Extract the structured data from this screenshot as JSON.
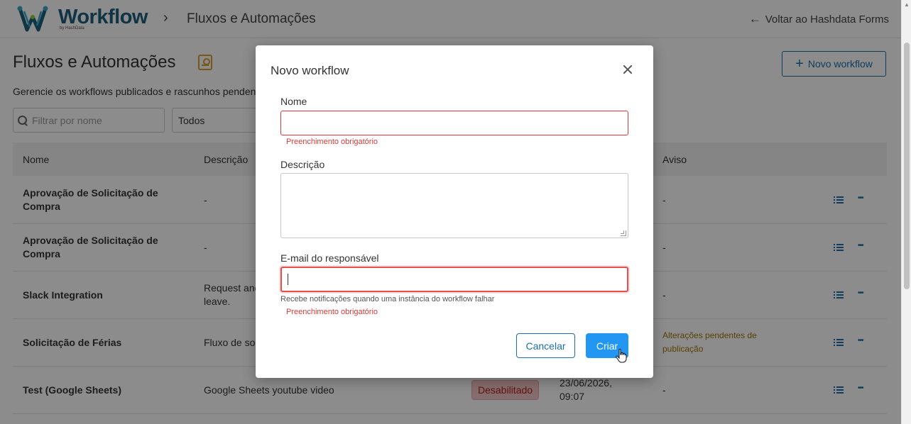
{
  "header": {
    "logo_text": "Workflow",
    "logo_sub": "by HashData",
    "breadcrumb_title": "Fluxos e Automações",
    "back_link": "Voltar ao Hashdata Forms"
  },
  "page": {
    "title": "Fluxos e Automações",
    "subtitle": "Gerencie os workflows publicados e rascunhos penden",
    "new_button": "Novo workflow",
    "filter_placeholder": "Filtrar por nome",
    "status_filter": "Todos"
  },
  "table": {
    "columns": [
      "Nome",
      "Descrição",
      "Aviso"
    ],
    "rows": [
      {
        "name": "Aprovação de Solicitação de Compra",
        "description": "-",
        "aviso": "-"
      },
      {
        "name": "Aprovação de Solicitação de Compra",
        "description": "-",
        "aviso": "-"
      },
      {
        "name": "Slack Integration",
        "description": "Request anc leave.",
        "aviso": "-"
      },
      {
        "name": "Solicitação de Férias",
        "description": "Fluxo de so",
        "aviso": "Alterações pendentes de publicação"
      },
      {
        "name": "Test (Google Sheets)",
        "description": "Google Sheets youtube video",
        "badge": "Desabilitado",
        "date": "23/06/2026, 09:07",
        "aviso": "-"
      }
    ]
  },
  "modal": {
    "title": "Novo workflow",
    "name_label": "Nome",
    "name_error": "Preenchimento obrigatório",
    "description_label": "Descrição",
    "email_label": "E-mail do responsável",
    "email_help": "Recebe notificações quando uma instância do workflow falhar",
    "email_error": "Preenchimento obrigatório",
    "cancel_button": "Cancelar",
    "create_button": "Criar"
  },
  "colors": {
    "brand": "#1c5f7c",
    "accent": "#2196f3",
    "error": "#d93a3a",
    "warning": "#a17608"
  },
  "icons": [
    "workflow-logo-icon",
    "chevron-right-icon",
    "arrow-left-icon",
    "user-card-icon",
    "plus-icon",
    "search-icon",
    "list-icon",
    "more-icon",
    "close-icon",
    "pointer-cursor-icon"
  ]
}
